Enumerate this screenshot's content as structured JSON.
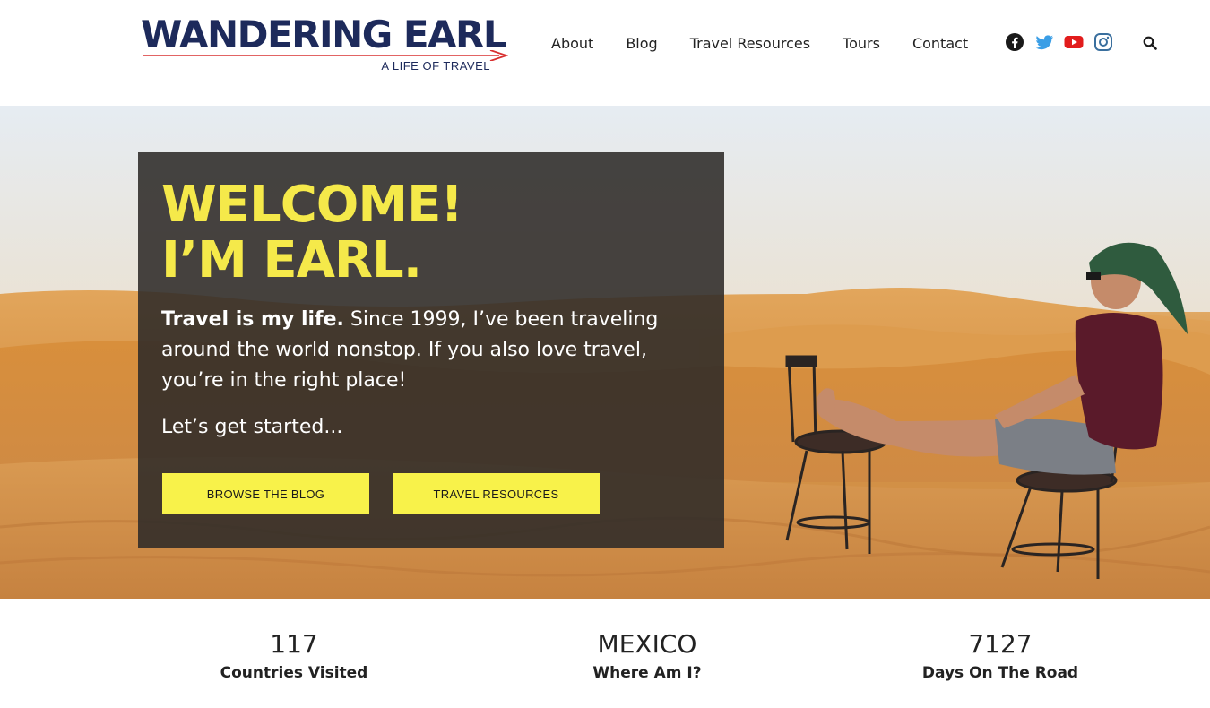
{
  "header": {
    "logo": {
      "title": "WANDERING EARL",
      "tagline": "A LIFE OF TRAVEL"
    },
    "nav": [
      {
        "label": "About"
      },
      {
        "label": "Blog"
      },
      {
        "label": "Travel Resources"
      },
      {
        "label": "Tours"
      },
      {
        "label": "Contact"
      }
    ],
    "social_icons": [
      "facebook-icon",
      "twitter-icon",
      "youtube-icon",
      "instagram-icon"
    ],
    "search_icon": "search-icon"
  },
  "hero": {
    "heading_line1": "WELCOME!",
    "heading_line2": "I’M EARL.",
    "intro_bold": "Travel is my life.",
    "intro_rest": " Since 1999, I’ve been traveling around the world nonstop. If you also love travel, you’re in the right place!",
    "subtext": "Let’s get started...",
    "buttons": {
      "blog": "BROWSE THE BLOG",
      "resources": "TRAVEL RESOURCES"
    }
  },
  "stats": [
    {
      "value": "117",
      "label": "Countries Visited"
    },
    {
      "value": "MEXICO",
      "label": "Where Am I?"
    },
    {
      "value": "7127",
      "label": "Days On The Road"
    }
  ],
  "colors": {
    "brand_navy": "#1d2a5b",
    "accent_yellow": "#f5e94a",
    "button_yellow": "#f8f24a",
    "arrow_red": "#d93030"
  }
}
